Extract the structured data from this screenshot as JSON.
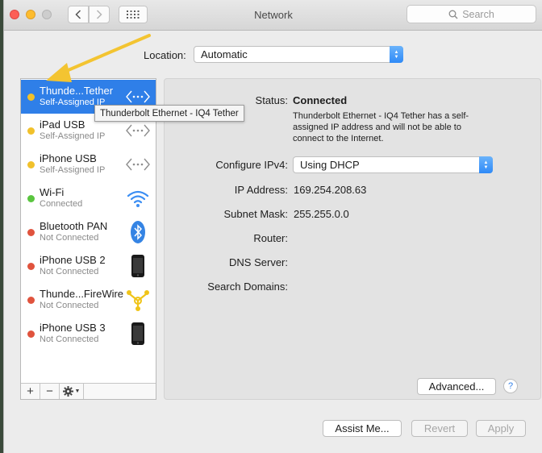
{
  "window": {
    "title": "Network",
    "search_placeholder": "Search"
  },
  "location": {
    "label": "Location:",
    "value": "Automatic"
  },
  "services": [
    {
      "name": "Thunde...Tether",
      "status": "Self-Assigned IP",
      "dot_color": "#f1c12b",
      "icon": "ethernet-arrows-icon",
      "selected": true
    },
    {
      "name": "iPad USB",
      "status": "Self-Assigned IP",
      "dot_color": "#f1c12b",
      "icon": "ethernet-arrows-icon"
    },
    {
      "name": "iPhone USB",
      "status": "Self-Assigned IP",
      "dot_color": "#f1c12b",
      "icon": "ethernet-arrows-icon"
    },
    {
      "name": "Wi-Fi",
      "status": "Connected",
      "dot_color": "#5ac53f",
      "icon": "wifi-icon"
    },
    {
      "name": "Bluetooth PAN",
      "status": "Not Connected",
      "dot_color": "#e0533d",
      "icon": "bluetooth-icon"
    },
    {
      "name": "iPhone USB 2",
      "status": "Not Connected",
      "dot_color": "#e0533d",
      "icon": "iphone-icon"
    },
    {
      "name": "Thunde...FireWire",
      "status": "Not Connected",
      "dot_color": "#e0533d",
      "icon": "firewire-icon"
    },
    {
      "name": "iPhone USB 3",
      "status": "Not Connected",
      "dot_color": "#e0533d",
      "icon": "iphone-icon"
    }
  ],
  "tooltip": "Thunderbolt Ethernet - IQ4 Tether",
  "sidebar_tools": {
    "add": "+",
    "remove": "−"
  },
  "detail": {
    "status_label": "Status:",
    "status_value": "Connected",
    "status_description": "Thunderbolt Ethernet - IQ4 Tether has a self-assigned IP address and will not be able to connect to the Internet.",
    "configure_label": "Configure IPv4:",
    "configure_value": "Using DHCP",
    "ip_label": "IP Address:",
    "ip_value": "169.254.208.63",
    "subnet_label": "Subnet Mask:",
    "subnet_value": "255.255.0.0",
    "router_label": "Router:",
    "dns_label": "DNS Server:",
    "search_domains_label": "Search Domains:",
    "advanced_label": "Advanced...",
    "help_label": "?"
  },
  "footer": {
    "assist_label": "Assist Me...",
    "revert_label": "Revert",
    "apply_label": "Apply"
  },
  "colors": {
    "selection": "#2f7fe8",
    "annotation_arrow": "#f3c431"
  }
}
